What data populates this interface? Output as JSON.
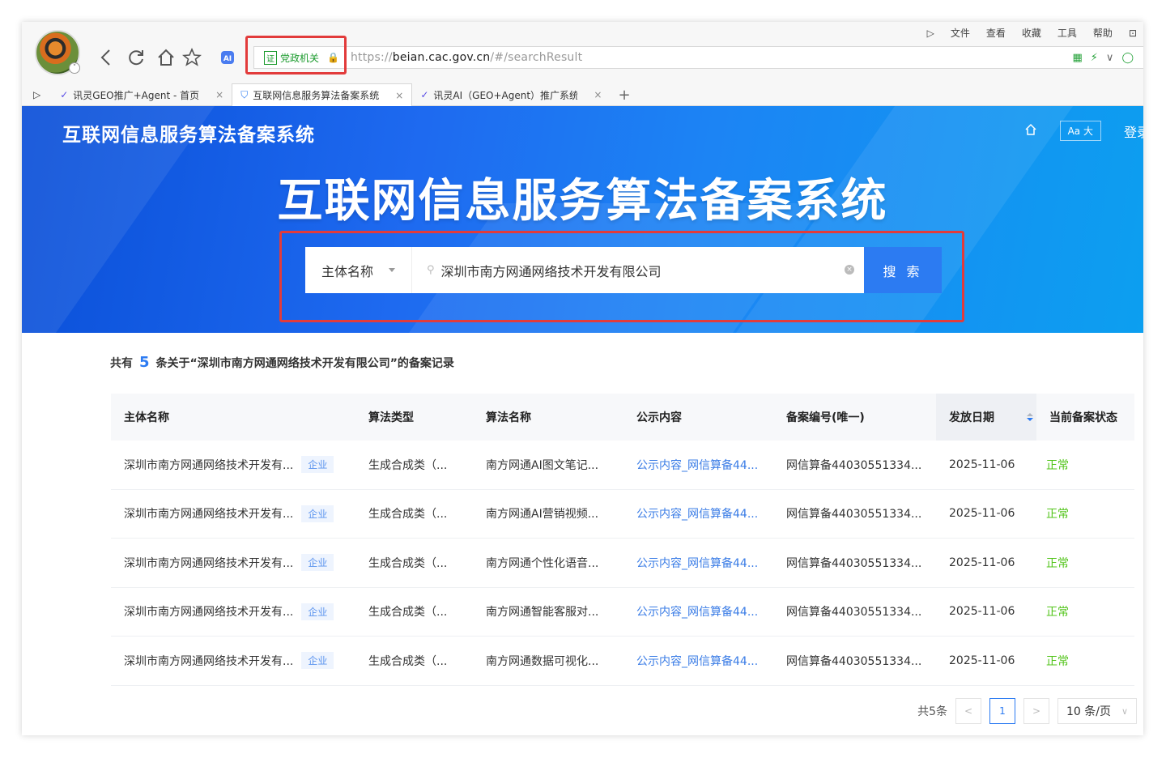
{
  "browser": {
    "menu": [
      "文件",
      "查看",
      "收藏",
      "工具",
      "帮助"
    ],
    "gov_label": "党政机关",
    "url_scheme": "https://",
    "url_domain": "beian.cac.gov.cn",
    "url_path": "/#/searchResult",
    "tabs": [
      {
        "title": "讯灵GEO推广+Agent - 首页",
        "active": false
      },
      {
        "title": "互联网信息服务算法备案系统",
        "active": true
      },
      {
        "title": "讯灵AI（GEO+Agent）推广系统",
        "active": false
      }
    ]
  },
  "site": {
    "brand": "互联网信息服务算法备案系统",
    "hero_title": "互联网信息服务算法备案系统",
    "font_toggle": "Aa 大",
    "login": "登录"
  },
  "search": {
    "field": "主体名称",
    "query": "深圳市南方网通网络技术开发有限公司",
    "button": "搜 索"
  },
  "summary": {
    "prefix": "共有",
    "count": "5",
    "suffix": "条关于“深圳市南方网通网络技术开发有限公司”的备案记录"
  },
  "table": {
    "headers": [
      "主体名称",
      "算法类型",
      "算法名称",
      "公示内容",
      "备案编号(唯一)",
      "发放日期",
      "当前备案状态"
    ],
    "rows": [
      {
        "subject": "深圳市南方网通网络技术开发有...",
        "tag": "企业",
        "type": "生成合成类（...",
        "name": "南方网通AI图文笔记...",
        "content": "公示内容_网信算备44...",
        "record": "网信算备44030551334...",
        "date": "2025-11-06",
        "status": "正常"
      },
      {
        "subject": "深圳市南方网通网络技术开发有...",
        "tag": "企业",
        "type": "生成合成类（...",
        "name": "南方网通AI营销视频...",
        "content": "公示内容_网信算备44...",
        "record": "网信算备44030551334...",
        "date": "2025-11-06",
        "status": "正常"
      },
      {
        "subject": "深圳市南方网通网络技术开发有...",
        "tag": "企业",
        "type": "生成合成类（...",
        "name": "南方网通个性化语音...",
        "content": "公示内容_网信算备44...",
        "record": "网信算备44030551334...",
        "date": "2025-11-06",
        "status": "正常"
      },
      {
        "subject": "深圳市南方网通网络技术开发有...",
        "tag": "企业",
        "type": "生成合成类（...",
        "name": "南方网通智能客服对...",
        "content": "公示内容_网信算备44...",
        "record": "网信算备44030551334...",
        "date": "2025-11-06",
        "status": "正常"
      },
      {
        "subject": "深圳市南方网通网络技术开发有...",
        "tag": "企业",
        "type": "生成合成类（...",
        "name": "南方网通数据可视化...",
        "content": "公示内容_网信算备44...",
        "record": "网信算备44030551334...",
        "date": "2025-11-06",
        "status": "正常"
      }
    ]
  },
  "pagination": {
    "total": "共5条",
    "current": "1",
    "page_size": "10 条/页"
  },
  "colors": {
    "accent": "#2c7bf2",
    "highlight_box": "#e23b3b",
    "status_ok": "#52c41a"
  }
}
